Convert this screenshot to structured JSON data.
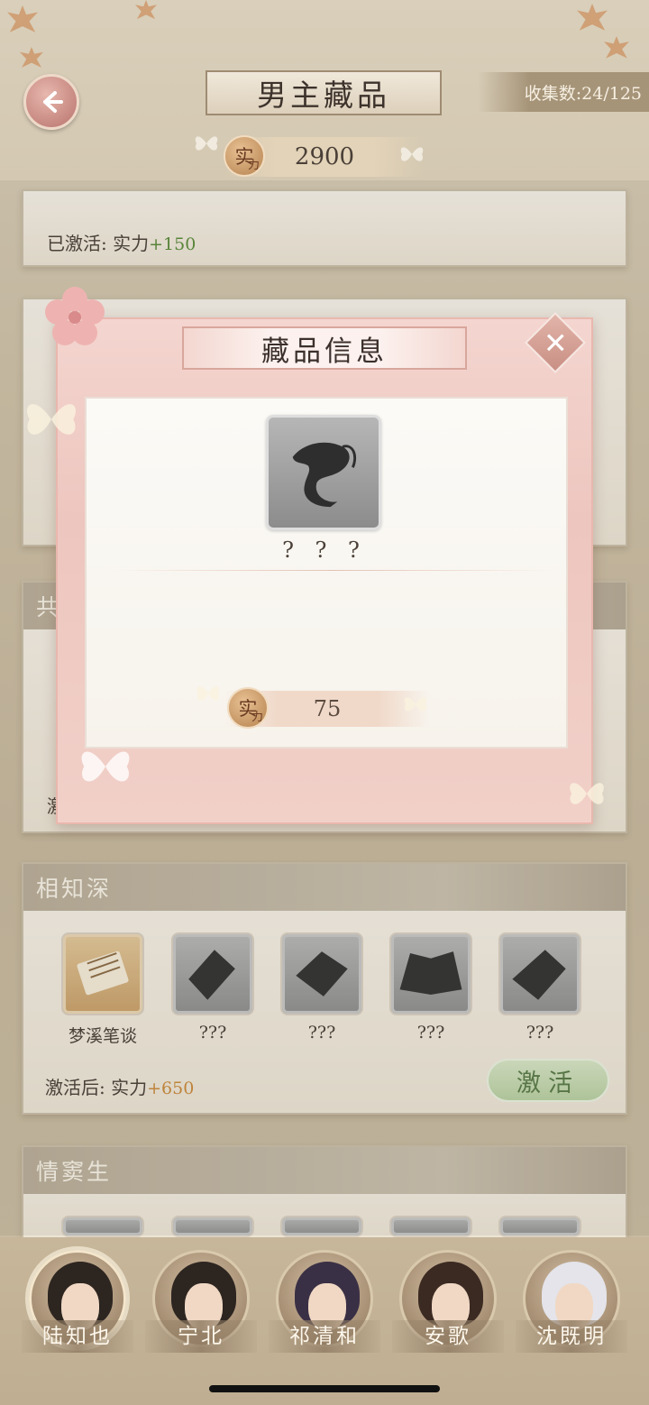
{
  "header": {
    "title": "男主藏品",
    "collect": "收集数:24/125",
    "power_badge": "实",
    "power_badge_sub": "力",
    "power_value": "2900"
  },
  "card_top": {
    "active_prefix": "已激活:",
    "active_stat": "实力",
    "active_bonus": "+150"
  },
  "card_partial": {
    "head_char": "共",
    "line_char": "激"
  },
  "card_xiangzhishen": {
    "title": "相知深",
    "items": [
      {
        "label": "梦溪笔谈",
        "owned": true
      },
      {
        "label": "???",
        "owned": false
      },
      {
        "label": "???",
        "owned": false
      },
      {
        "label": "???",
        "owned": false
      },
      {
        "label": "???",
        "owned": false
      }
    ],
    "after_prefix": "激活后:",
    "after_stat": "实力",
    "after_bonus": "+650",
    "activate_label": "激活"
  },
  "card_qingdousheng": {
    "title": "情窦生"
  },
  "modal": {
    "title": "藏品信息",
    "close_symbol": "✕",
    "item_name": "? ? ?",
    "power_badge": "实",
    "power_badge_sub": "力",
    "power_value": "75"
  },
  "characters": [
    {
      "name": "陆知也",
      "selected": true
    },
    {
      "name": "宁北",
      "selected": false
    },
    {
      "name": "祁清和",
      "selected": false
    },
    {
      "name": "安歌",
      "selected": false
    },
    {
      "name": "沈既明",
      "selected": false
    }
  ],
  "colors": {
    "accent_green": "#5b8a3a",
    "accent_orange": "#c98a3c",
    "modal_pink": "#edc6bf"
  }
}
